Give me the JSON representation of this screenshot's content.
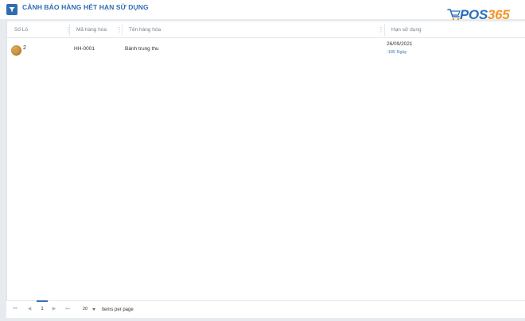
{
  "header": {
    "title": "CẢNH BÁO HÀNG HẾT HẠN SỬ DỤNG",
    "filter_icon": "filter-icon"
  },
  "logo": {
    "prefix": "POS",
    "number": "365",
    "brand_color": "#2a6fba",
    "accent_color": "#f29524"
  },
  "table": {
    "columns": [
      "Số Lô",
      "Mã hàng hóa",
      "Tên hàng hóa",
      "Hạn sử dụng"
    ],
    "rows": [
      {
        "lot": "2",
        "code": "HH-0001",
        "name": "Bánh trung thu",
        "expiry_date": "26/09/2021",
        "days_left": "-185 Ngày"
      }
    ]
  },
  "pagination": {
    "first": "⏮",
    "prev": "◀",
    "current_page": "1",
    "next": "▶",
    "last": "⏭",
    "page_size": "20",
    "per_page_label": "items per page"
  }
}
